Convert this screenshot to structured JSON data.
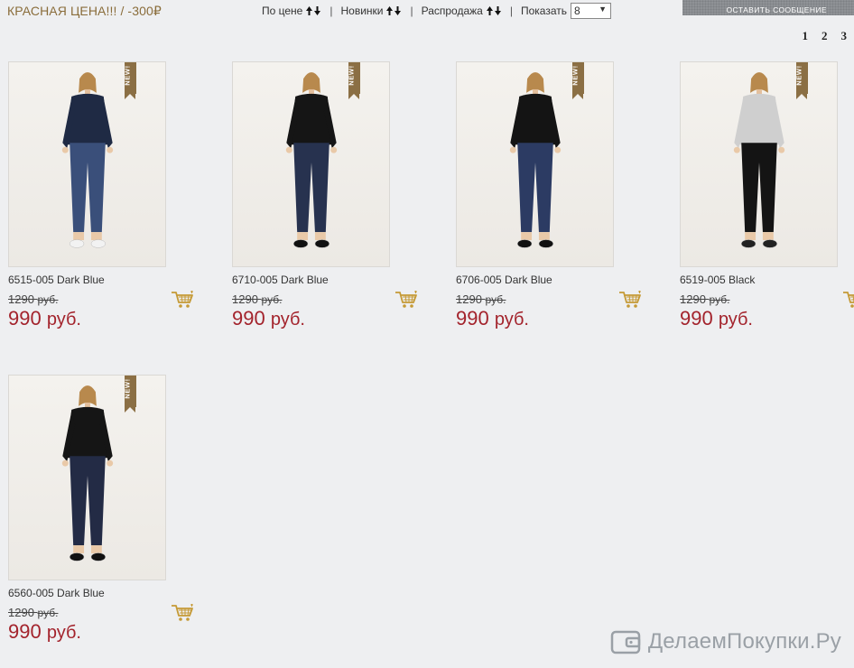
{
  "header": {
    "title": "КРАСНАЯ ЦЕНА!!! / -300₽"
  },
  "sortbar": {
    "by_price": "По цене",
    "new_items": "Новинки",
    "sale": "Распродажа",
    "separator": "|",
    "show_label": "Показать",
    "show_value": "8",
    "caret": "▼"
  },
  "message_bar": {
    "label": "ОСТАВИТЬ СООБЩЕНИЕ"
  },
  "pagination": {
    "pages": [
      "1",
      "2",
      "3"
    ]
  },
  "badge": "NEW!",
  "currency": "руб.",
  "products": [
    {
      "name": "6515-005 Dark Blue",
      "old_price": "1290",
      "price": "990",
      "top_color": "#1f2a44",
      "jeans_color": "#3a4f7a",
      "shoes_color": "#f2f2f2"
    },
    {
      "name": "6710-005 Dark Blue",
      "old_price": "1290",
      "price": "990",
      "top_color": "#151515",
      "jeans_color": "#27324f",
      "shoes_color": "#111111"
    },
    {
      "name": "6706-005 Dark Blue",
      "old_price": "1290",
      "price": "990",
      "top_color": "#141414",
      "jeans_color": "#2c3b63",
      "shoes_color": "#111111"
    },
    {
      "name": "6519-005 Black",
      "old_price": "1290",
      "price": "990",
      "top_color": "#cfcfcf",
      "jeans_color": "#141414",
      "shoes_color": "#222222"
    },
    {
      "name": "6560-005 Dark Blue",
      "old_price": "1290",
      "price": "990",
      "top_color": "#151515",
      "jeans_color": "#232b45",
      "shoes_color": "#111111"
    }
  ],
  "watermark": {
    "text": "ДелаемПокупки.Ру"
  },
  "colors": {
    "title": "#8a6d3b",
    "price": "#a3232c",
    "ribbon": "#8b6f44",
    "cart": "#c59a36"
  }
}
